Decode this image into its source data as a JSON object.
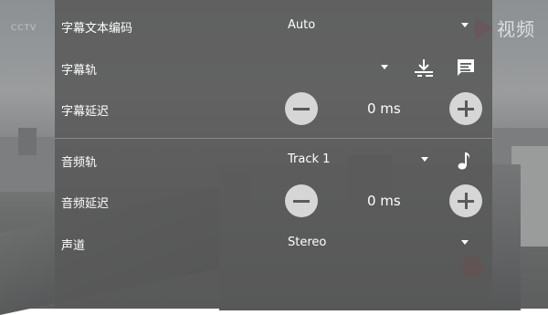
{
  "settings": {
    "subtitle_encoding": {
      "label": "字幕文本编码",
      "value": "Auto"
    },
    "subtitle_track": {
      "label": "字幕轨"
    },
    "subtitle_delay": {
      "label": "字幕延迟",
      "value": "0 ms"
    },
    "audio_track": {
      "label": "音频轨",
      "value": "Track 1"
    },
    "audio_delay": {
      "label": "音频延迟",
      "value": "0 ms"
    },
    "channel": {
      "label": "声道",
      "value": "Stereo"
    }
  },
  "video": {
    "channel_logo_text": "视频"
  },
  "icons": {
    "download": "download-subtitle-icon",
    "subtitle": "subtitle-icon",
    "music": "music-note-icon"
  }
}
